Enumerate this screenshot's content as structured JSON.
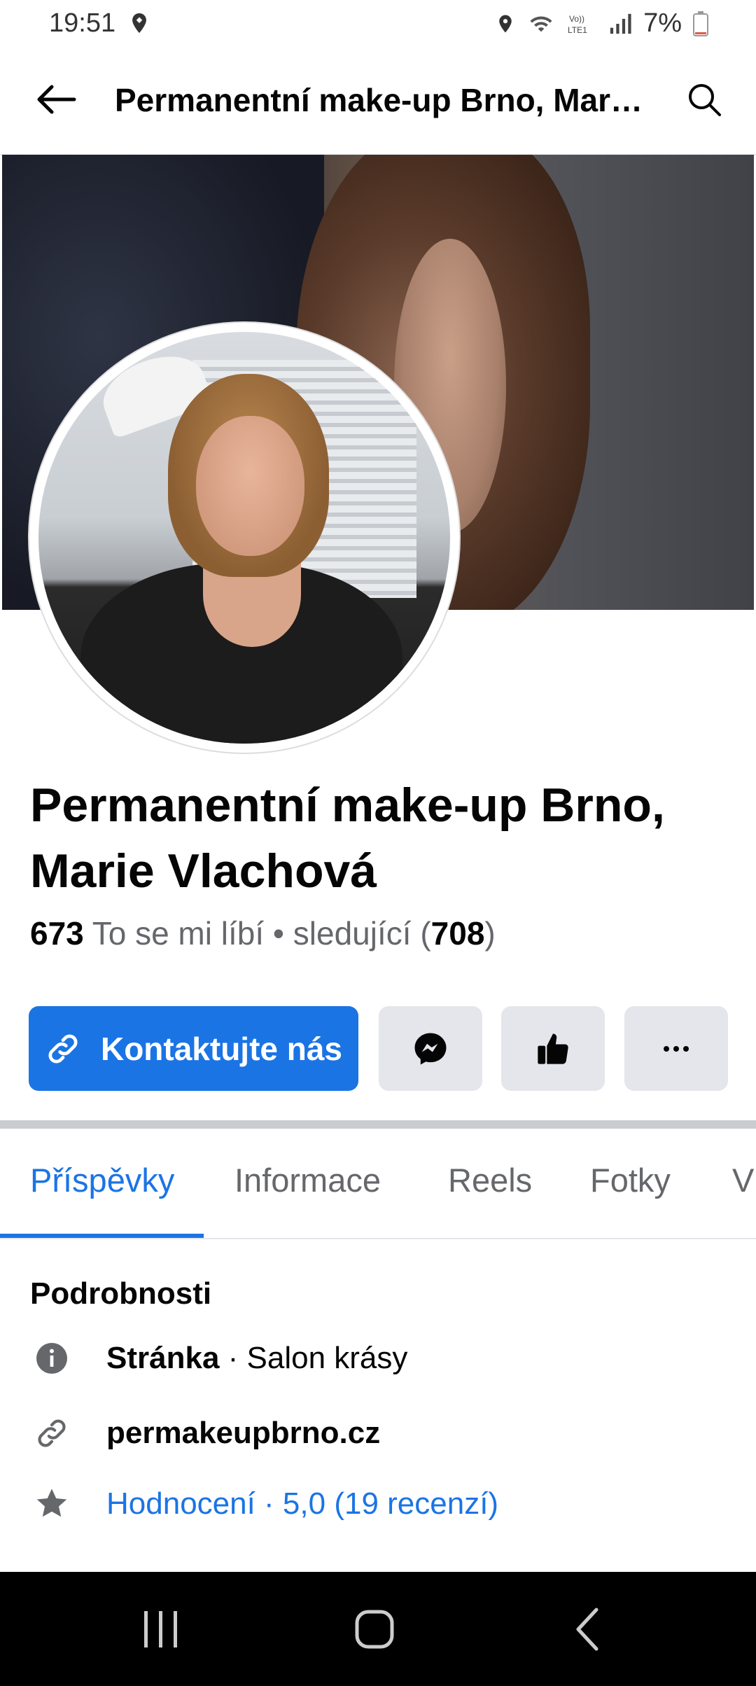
{
  "status_bar": {
    "time": "19:51",
    "battery": "7%"
  },
  "appbar": {
    "title": "Permanentní make-up Brno, Mari…"
  },
  "page": {
    "name_line1": "Permanentní make-up Brno,",
    "name_line2": "Marie Vlachová",
    "likes_count": "673",
    "likes_label": "To se mi líbí",
    "separator": "•",
    "followers_label": "sledující",
    "followers_count": "708"
  },
  "actions": {
    "contact_label": "Kontaktujte nás"
  },
  "tabs": [
    {
      "label": "Příspěvky",
      "active": true
    },
    {
      "label": "Informace"
    },
    {
      "label": "Reels"
    },
    {
      "label": "Fotky"
    },
    {
      "label": "V"
    }
  ],
  "details": {
    "title": "Podrobnosti",
    "category_bold": "Stránka",
    "category_rest": " · Salon krásy",
    "website": "permakeupbrno.cz",
    "rating": "Hodnocení · 5,0 (19 recenzí)"
  },
  "colors": {
    "accent": "#1b74e4",
    "button_grey": "#e4e6eb"
  },
  "icons": [
    "back-arrow-icon",
    "search-icon",
    "link-icon",
    "messenger-icon",
    "like-icon",
    "more-icon",
    "info-icon",
    "star-icon"
  ]
}
